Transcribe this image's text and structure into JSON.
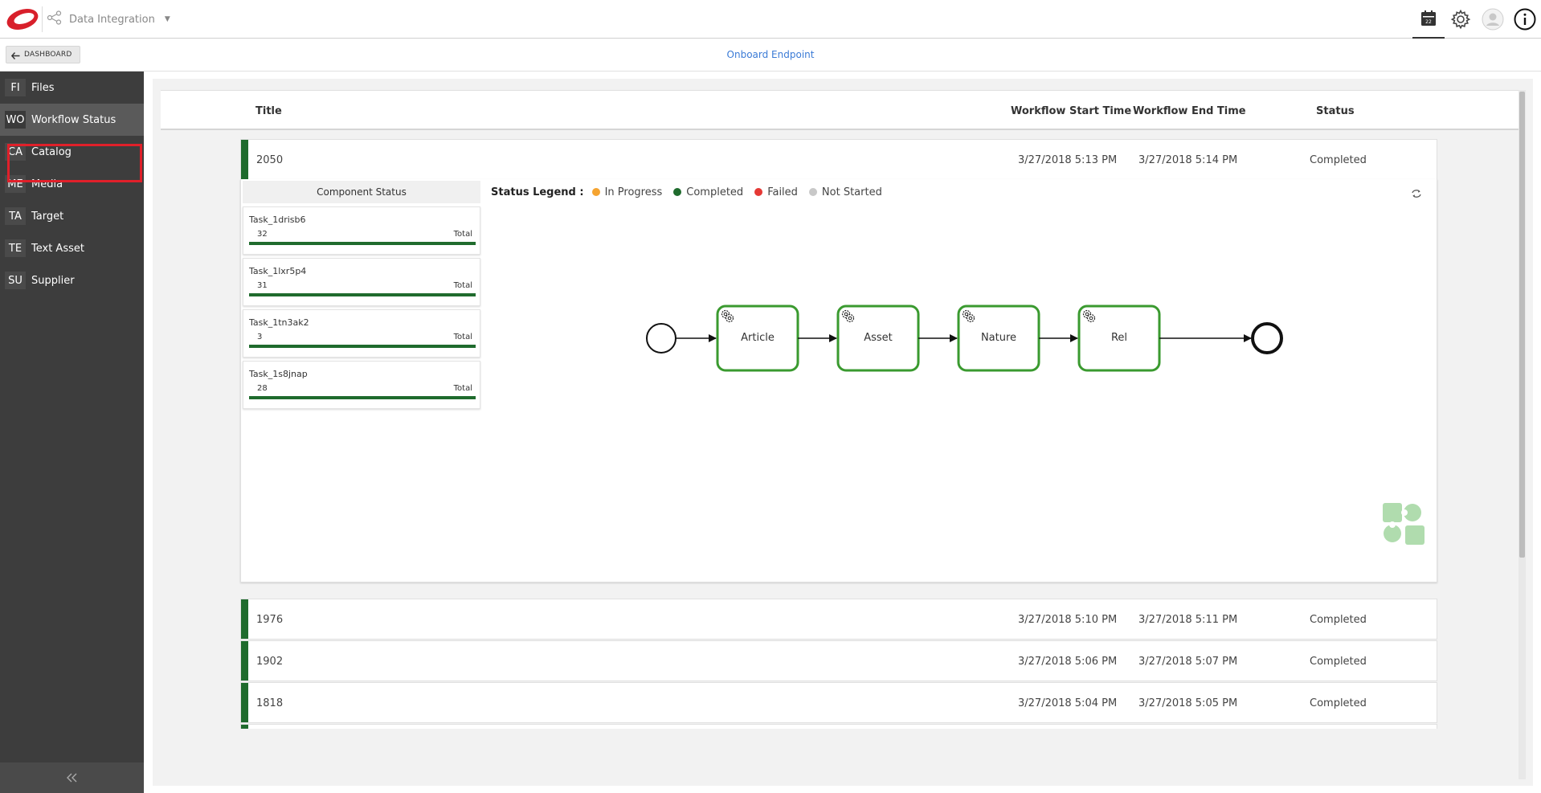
{
  "app": {
    "name": "Data Integration",
    "accent": "#3b7bd6",
    "logo_red": "#d8202b"
  },
  "top_icons": [
    "calendar-icon",
    "gear-icon",
    "user-avatar-icon",
    "info-icon"
  ],
  "subbar": {
    "dashboard_label": "DASHBOARD",
    "page_title": "Onboard Endpoint"
  },
  "sidebar": {
    "items": [
      {
        "abbr": "FI",
        "label": "Files"
      },
      {
        "abbr": "WO",
        "label": "Workflow Status"
      },
      {
        "abbr": "CA",
        "label": "Catalog"
      },
      {
        "abbr": "ME",
        "label": "Media"
      },
      {
        "abbr": "TA",
        "label": "Target"
      },
      {
        "abbr": "TE",
        "label": "Text Asset"
      },
      {
        "abbr": "SU",
        "label": "Supplier"
      }
    ],
    "active_index": 1,
    "highlighted_index": 2
  },
  "grid": {
    "headers": {
      "title": "Title",
      "start": "Workflow Start Time",
      "end": "Workflow End Time",
      "status": "Status"
    },
    "rows": [
      {
        "title": "2050",
        "start": "3/27/2018 5:13 PM",
        "end": "3/27/2018 5:14 PM",
        "status": "Completed"
      },
      {
        "title": "1976",
        "start": "3/27/2018 5:10 PM",
        "end": "3/27/2018 5:11 PM",
        "status": "Completed"
      },
      {
        "title": "1902",
        "start": "3/27/2018 5:06 PM",
        "end": "3/27/2018 5:07 PM",
        "status": "Completed"
      },
      {
        "title": "1818",
        "start": "3/27/2018 5:04 PM",
        "end": "3/27/2018 5:05 PM",
        "status": "Completed"
      }
    ]
  },
  "detail": {
    "component_status_title": "Component Status",
    "total_label": "Total",
    "tasks": [
      {
        "name": "Task_1drisb6",
        "count": "32"
      },
      {
        "name": "Task_1lxr5p4",
        "count": "31"
      },
      {
        "name": "Task_1tn3ak2",
        "count": "3"
      },
      {
        "name": "Task_1s8jnap",
        "count": "28"
      }
    ],
    "legend": {
      "title": "Status Legend :",
      "items": [
        {
          "label": "In Progress",
          "color": "#f5a431"
        },
        {
          "label": "Completed",
          "color": "#1f6b2d"
        },
        {
          "label": "Failed",
          "color": "#e53935"
        },
        {
          "label": "Not Started",
          "color": "#c8c8c8"
        }
      ]
    },
    "flow_steps": [
      "Article",
      "Asset",
      "Nature",
      "Rel"
    ],
    "step_border_color": "#3a9a2f"
  }
}
